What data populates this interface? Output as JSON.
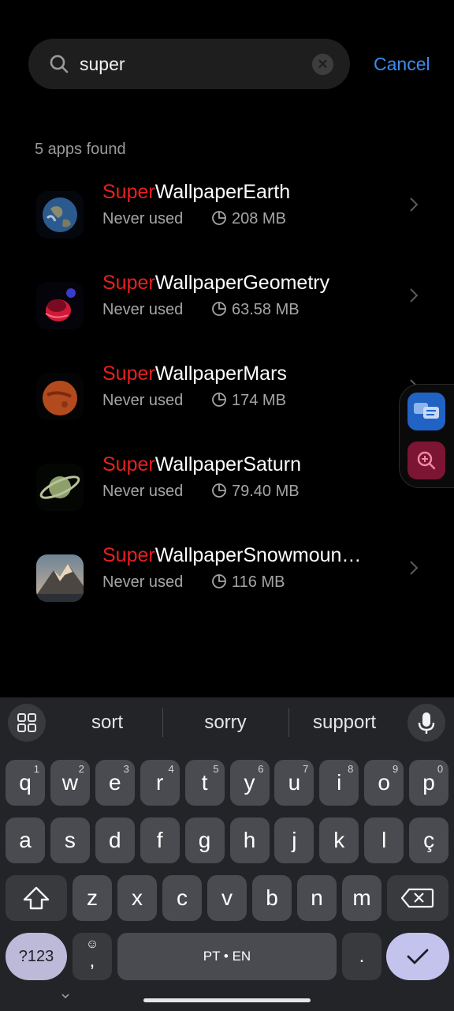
{
  "search": {
    "query": "super",
    "cancel_label": "Cancel"
  },
  "results": {
    "count_label": "5 apps found",
    "apps": [
      {
        "highlight": "Super",
        "rest": "WallpaperEarth",
        "usage": "Never used",
        "size": "208 MB"
      },
      {
        "highlight": "Super",
        "rest": "WallpaperGeometry",
        "usage": "Never used",
        "size": "63.58 MB"
      },
      {
        "highlight": "Super",
        "rest": "WallpaperMars",
        "usage": "Never used",
        "size": "174 MB"
      },
      {
        "highlight": "Super",
        "rest": "WallpaperSaturn",
        "usage": "Never used",
        "size": "79.40 MB"
      },
      {
        "highlight": "Super",
        "rest": "WallpaperSnowmoun…",
        "usage": "Never used",
        "size": "116 MB"
      }
    ]
  },
  "keyboard": {
    "suggestions": [
      "sort",
      "sorry",
      "support"
    ],
    "row1": [
      {
        "k": "q",
        "n": "1"
      },
      {
        "k": "w",
        "n": "2"
      },
      {
        "k": "e",
        "n": "3"
      },
      {
        "k": "r",
        "n": "4"
      },
      {
        "k": "t",
        "n": "5"
      },
      {
        "k": "y",
        "n": "6"
      },
      {
        "k": "u",
        "n": "7"
      },
      {
        "k": "i",
        "n": "8"
      },
      {
        "k": "o",
        "n": "9"
      },
      {
        "k": "p",
        "n": "0"
      }
    ],
    "row2": [
      "a",
      "s",
      "d",
      "f",
      "g",
      "h",
      "j",
      "k",
      "l",
      "ç"
    ],
    "row3": [
      "z",
      "x",
      "c",
      "v",
      "b",
      "n",
      "m"
    ],
    "symbols_label": "?123",
    "emoji_comma_label": ",",
    "space_label": "PT • EN",
    "period_label": "."
  },
  "colors": {
    "highlight": "#e8201f",
    "accent": "#3c8cf0",
    "enter_key": "#c4c3ee",
    "symbols_key": "#bcbad8"
  }
}
